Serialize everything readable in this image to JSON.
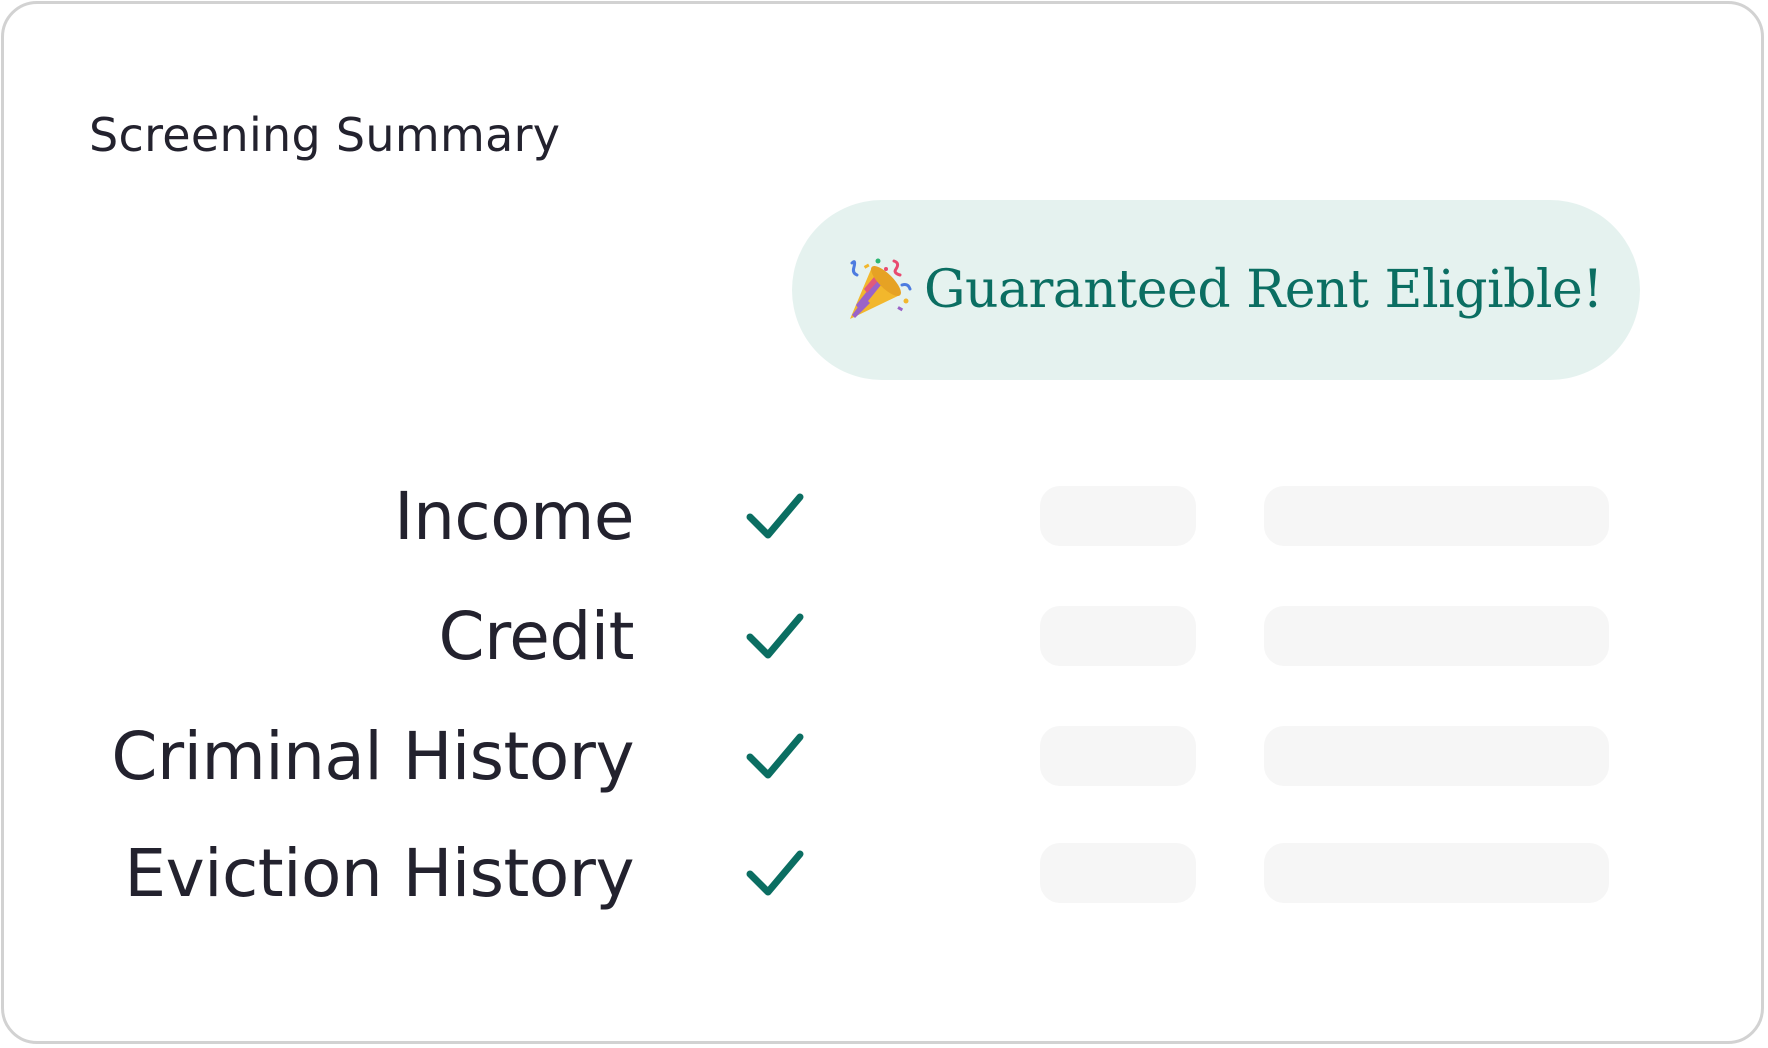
{
  "summary": {
    "title": "Screening Summary",
    "badge": {
      "icon": "party-popper-icon",
      "text": "Guaranteed Rent Eligible!",
      "background": "#e5f2ef",
      "text_color": "#0b6e62"
    },
    "checks": [
      {
        "label": "Income",
        "status": "passed"
      },
      {
        "label": "Credit",
        "status": "passed"
      },
      {
        "label": "Criminal History",
        "status": "passed"
      },
      {
        "label": "Eviction History",
        "status": "passed"
      }
    ],
    "check_color": "#0b6e62",
    "placeholder_color": "#f6f6f6"
  }
}
